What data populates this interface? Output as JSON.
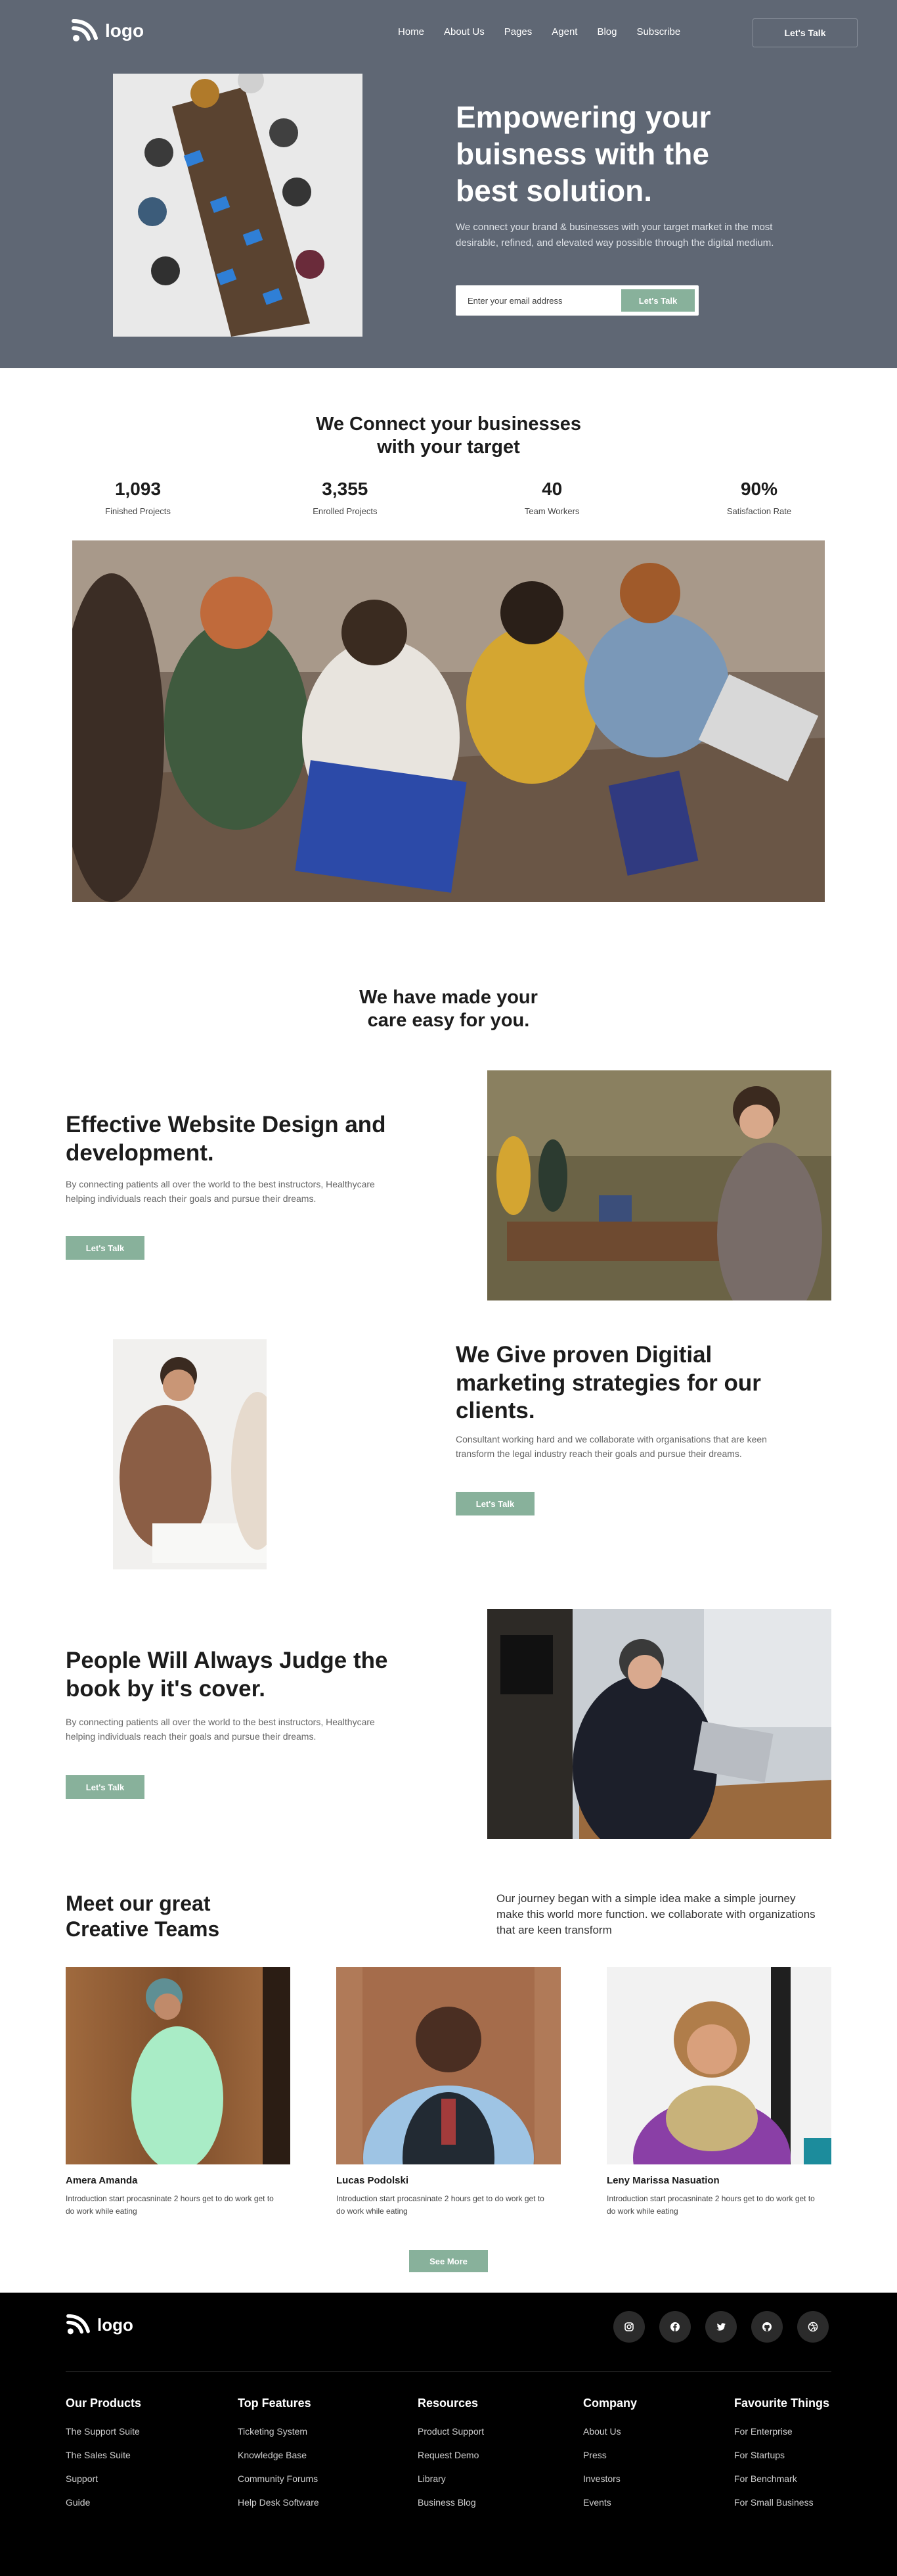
{
  "nav": {
    "logo_text": "logo",
    "links": [
      "Home",
      "About Us",
      "Pages",
      "Agent",
      "Blog",
      "Subscribe"
    ],
    "cta": "Let's Talk"
  },
  "hero": {
    "title": "Empowering your buisness with the best solution.",
    "description": "We connect your brand & businesses with your target market in the most desirable, refined, and elevated way possible through the digital medium.",
    "email_placeholder": "Enter your email address",
    "button": "Let's Talk"
  },
  "connect": {
    "title": "We Connect your businesses with your target",
    "stats": [
      {
        "value": "1,093",
        "label": "Finished Projects"
      },
      {
        "value": "3,355",
        "label": "Enrolled Projects"
      },
      {
        "value": "40",
        "label": "Team Workers"
      },
      {
        "value": "90%",
        "label": "Satisfaction Rate"
      }
    ]
  },
  "care": {
    "title": "We have made your care easy for you."
  },
  "features": [
    {
      "title": "Effective Website Design and development.",
      "description": "By connecting patients all over the world to the best instructors, Healthycare helping individuals reach their goals and pursue their dreams.",
      "button": "Let's Talk"
    },
    {
      "title": "We Give proven Digitial marketing strategies for our clients.",
      "description": "Consultant working hard and we collaborate with organisations that are keen transform the legal industry reach their goals and pursue their dreams.",
      "button": "Let's Talk"
    },
    {
      "title": "People Will Always Judge the book by it's cover.",
      "description": "By connecting patients all over the world to the best instructors, Healthycare helping individuals reach their goals and pursue their dreams.",
      "button": "Let's Talk"
    }
  ],
  "team": {
    "title": "Meet our great Creative Teams",
    "intro": "Our journey began with a simple idea make a simple journey make this world more function. we collaborate with organizations that are keen transform",
    "members": [
      {
        "name": "Amera Amanda",
        "description": "Introduction start procasninate 2 hours get to do work get to do work while eating"
      },
      {
        "name": "Lucas Podolski",
        "description": "Introduction start procasninate 2 hours get to do work get to do work while eating"
      },
      {
        "name": "Leny Marissa Nasuation",
        "description": "Introduction start procasninate 2 hours get to do work get to do work while eating"
      }
    ],
    "see_more": "See More"
  },
  "footer": {
    "logo_text": "logo",
    "socials": [
      "instagram-icon",
      "facebook-icon",
      "twitter-icon",
      "github-icon",
      "dribbble-icon"
    ],
    "columns": [
      {
        "title": "Our Products",
        "links": [
          "The Support Suite",
          "The Sales Suite",
          "Support",
          "Guide"
        ]
      },
      {
        "title": "Top Features",
        "links": [
          "Ticketing System",
          "Knowledge Base",
          "Community Forums",
          "Help Desk Software"
        ]
      },
      {
        "title": "Resources",
        "links": [
          "Product Support",
          "Request Demo",
          "Library",
          "Business Blog"
        ]
      },
      {
        "title": "Company",
        "links": [
          "About Us",
          "Press",
          "Investors",
          "Events"
        ]
      },
      {
        "title": "Favourite Things",
        "links": [
          "For Enterprise",
          "For Startups",
          "For Benchmark",
          "For Small Business"
        ]
      }
    ]
  },
  "colors": {
    "hero_bg": "#5f6774",
    "accent_green": "#88b19b",
    "footer_bg": "#000000"
  }
}
